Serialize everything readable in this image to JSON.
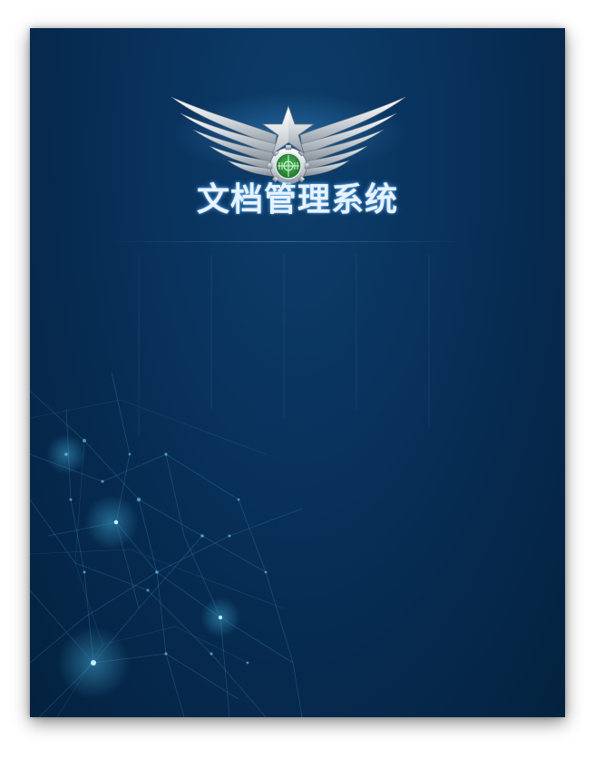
{
  "app": {
    "title": "文档管理系统"
  },
  "emblem": {
    "icon": "winged-star-emblem-icon"
  },
  "colors": {
    "background": "#062a4f",
    "title_text": "#e8f3ff",
    "title_glow": "#50aaff"
  }
}
